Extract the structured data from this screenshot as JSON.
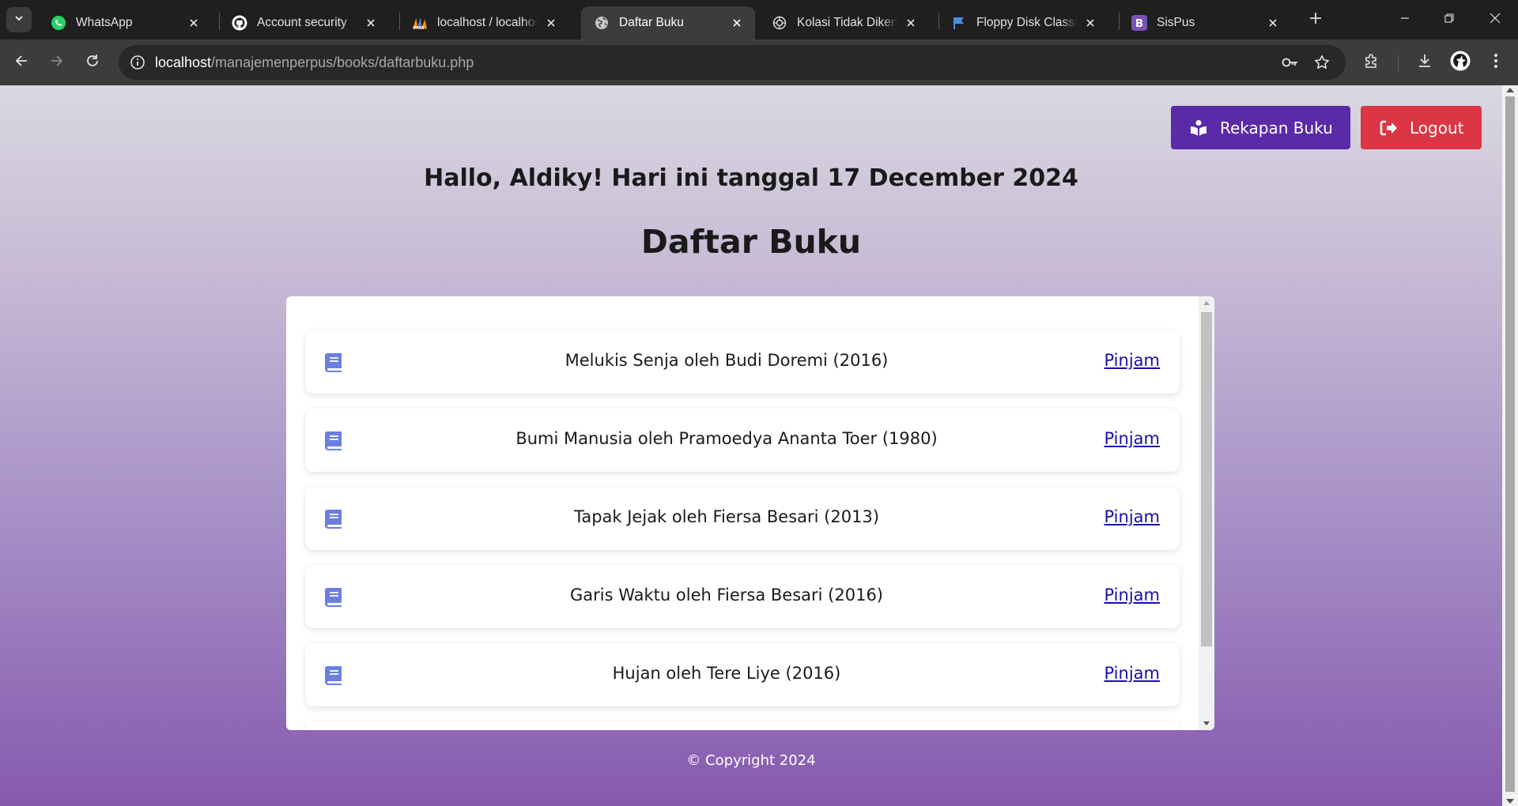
{
  "browser": {
    "tabs": [
      {
        "title": "WhatsApp",
        "icon": "whatsapp-icon",
        "active": false
      },
      {
        "title": "Account security",
        "icon": "github-icon",
        "active": false
      },
      {
        "title": "localhost / localhost / ",
        "icon": "phpmyadmin-icon",
        "active": false
      },
      {
        "title": "Daftar Buku",
        "icon": "globe-icon",
        "active": true
      },
      {
        "title": "Kolasi Tidak Dikenal Di",
        "icon": "chatgpt-icon",
        "active": false
      },
      {
        "title": "Floppy Disk Classic Lin",
        "icon": "flag-icon",
        "active": false
      },
      {
        "title": "SisPus",
        "icon": "bootstrap-icon",
        "active": false
      }
    ],
    "url": {
      "host": "localhost",
      "path": "/manajemenperpus/books/daftarbuku.php"
    },
    "colors": {
      "frame": "#1f1f1f",
      "toolbar": "#3c3c3c",
      "omnibox": "#282828"
    }
  },
  "page": {
    "nav": {
      "rekap_label": "Rekapan Buku",
      "logout_label": "Logout"
    },
    "greeting": "Hallo, Aldiky! Hari ini tanggal 17 December 2024",
    "title": "Daftar Buku",
    "books": [
      {
        "text": "Melukis Senja oleh Budi Doremi (2016)",
        "action": "Pinjam"
      },
      {
        "text": "Bumi Manusia oleh Pramoedya Ananta Toer (1980)",
        "action": "Pinjam"
      },
      {
        "text": "Tapak Jejak oleh Fiersa Besari (2013)",
        "action": "Pinjam"
      },
      {
        "text": "Garis Waktu oleh Fiersa Besari (2016)",
        "action": "Pinjam"
      },
      {
        "text": "Hujan oleh Tere Liye (2016)",
        "action": "Pinjam"
      }
    ],
    "footer": "© Copyright 2024",
    "colors": {
      "rekap": "#5b2aa9",
      "logout": "#dc3545",
      "book_icon": "#6b7fe0",
      "link": "#1a0dab"
    }
  }
}
